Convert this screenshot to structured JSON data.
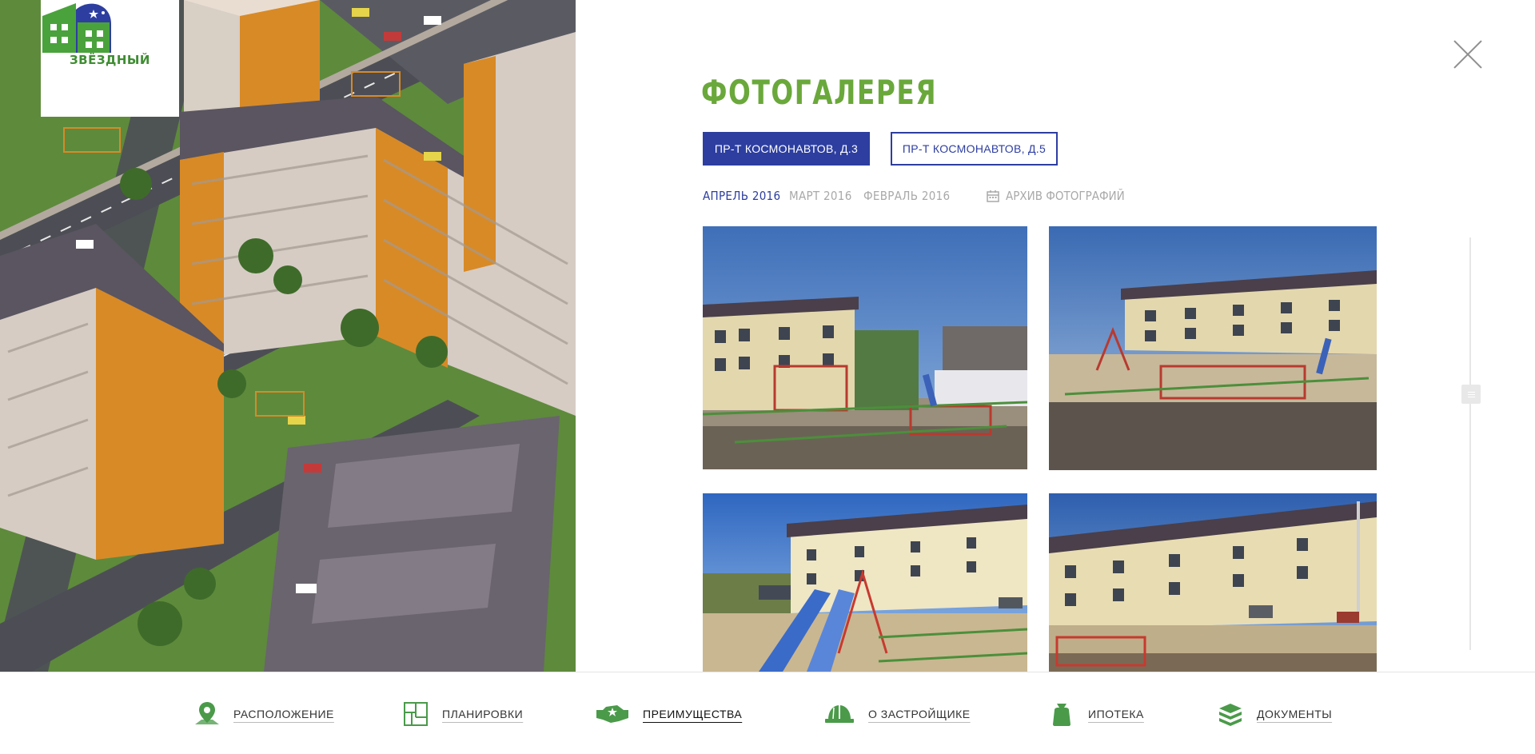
{
  "brand": {
    "name": "ЗВЁЗДНЫЙ"
  },
  "gallery": {
    "title": "ФОТОГАЛЕРЕЯ",
    "addresses": [
      "ПР-Т КОСМОНАВТОВ, Д.3",
      "ПР-Т КОСМОНАВТОВ, Д.5"
    ],
    "selected_address": "ПР-Т КОСМОНАВТОВ, Д.3",
    "months": [
      "АПРЕЛЬ 2016",
      "МАРТ 2016",
      "ФЕВРАЛЬ 2016"
    ],
    "selected_month": "АПРЕЛЬ 2016",
    "archive_label": "АРХИВ ФОТОГРАФИЙ",
    "photo_count": 4
  },
  "bottom_nav": {
    "items": [
      {
        "label": "РАСПОЛОЖЕНИЕ",
        "icon": "location-pin-icon"
      },
      {
        "label": "ПЛАНИРОВКИ",
        "icon": "floor-plan-icon"
      },
      {
        "label": "ПРЕИМУЩЕСТВА",
        "icon": "advantages-icon"
      },
      {
        "label": "О ЗАСТРОЙЩИКЕ",
        "icon": "builder-helmet-icon"
      },
      {
        "label": "ИПОТЕКА",
        "icon": "money-bag-icon"
      },
      {
        "label": "ДОКУМЕНТЫ",
        "icon": "documents-stack-icon"
      }
    ],
    "current": "ПРЕИМУЩЕСТВА"
  },
  "colors": {
    "brand_green": "#6aa83b",
    "brand_blue": "#2d3ea0",
    "muted_text": "#a9a9a9",
    "nav_icon_green": "#4a9a4a"
  }
}
